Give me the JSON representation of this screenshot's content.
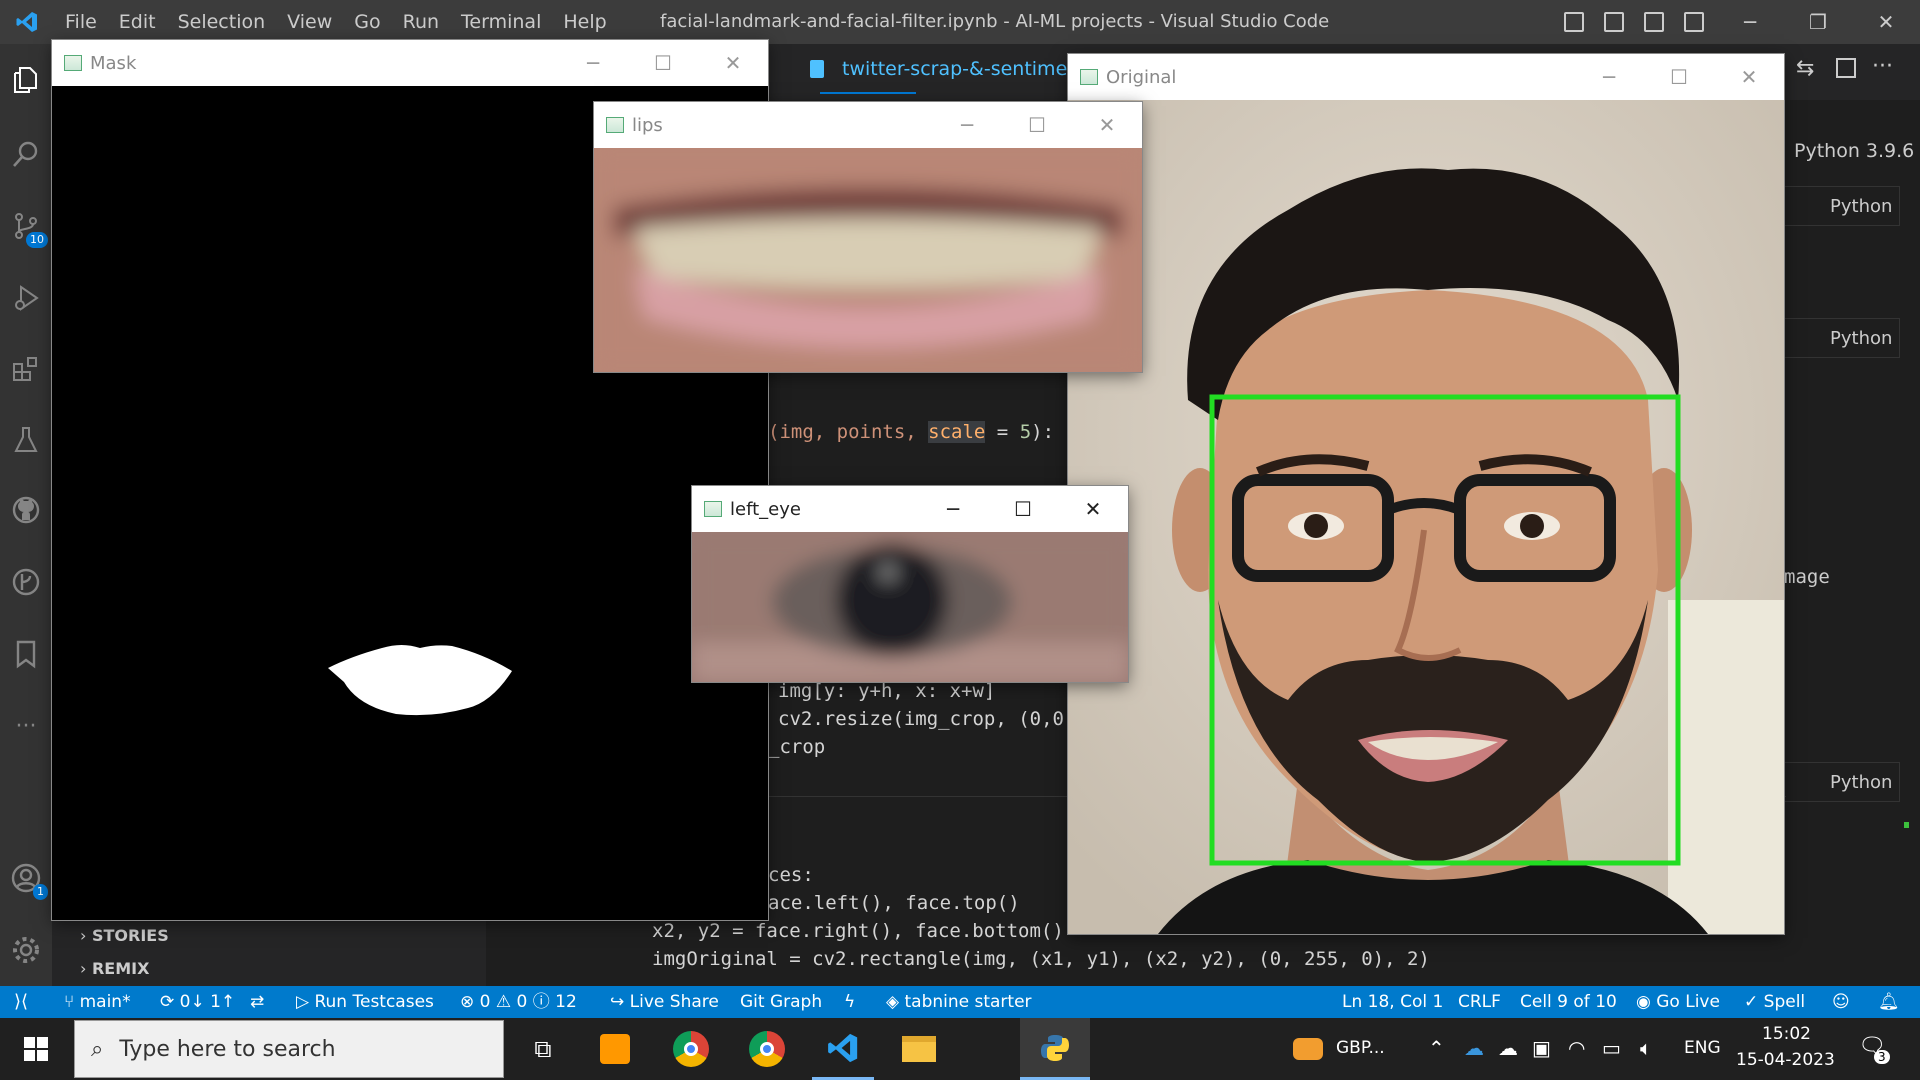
{
  "vscode": {
    "menu": [
      "File",
      "Edit",
      "Selection",
      "View",
      "Go",
      "Run",
      "Terminal",
      "Help"
    ],
    "window_title": "facial-landmark-and-facial-filter.ipynb - AI-ML projects - Visual Studio Code",
    "tab_label": "twitter-scrap-&-sentiment",
    "python_version": "Python 3.9.6",
    "cell_language": "Python",
    "partial_text_image": "mage",
    "activity_badges": {
      "source_control": "10",
      "accounts": "1"
    },
    "sidebar_sections": [
      "STORIES",
      "REMIX"
    ],
    "code_lines": {
      "line1_a": "(img, points, ",
      "line1_scale": "scale",
      "line1_b": " = ",
      "line1_num": "5",
      "line1_c": "):",
      "line2": "img[y: y+h, x: x+w]",
      "line3": "cv2.resize(img_crop, (0,0",
      "line4": "_crop",
      "line5": "ces:",
      "line6": "ace.left(), face.top()",
      "line7": "x2, y2 = face.right(), face.bottom()",
      "line8": "imgOriginal = cv2.rectangle(img, (x1, y1), (x2, y2), (0, 255, 0), 2)"
    }
  },
  "windows": {
    "mask": {
      "title": "Mask"
    },
    "lips": {
      "title": "lips"
    },
    "left_eye": {
      "title": "left_eye"
    },
    "original": {
      "title": "Original"
    }
  },
  "statusbar": {
    "branch": "main*",
    "sync": "0↓ 1↑",
    "run_testcases": "Run Testcases",
    "problems": "0 ⚠ 0 ⓘ 12",
    "live_share": "Live Share",
    "git_graph": "Git Graph",
    "tabnine": "tabnine starter",
    "position": "Ln 18, Col 1",
    "eol": "CRLF",
    "cell": "Cell 9 of 10",
    "go_live": "Go Live",
    "spell": "Spell"
  },
  "taskbar": {
    "search_placeholder": "Type here to search",
    "weather": "GBP...",
    "language": "ENG",
    "time": "15:02",
    "date": "15-04-2023",
    "notifications": "3"
  },
  "colors": {
    "statusbar": "#007acc",
    "face_box": "#22dd22",
    "titlebar": "#3c3c3c"
  }
}
